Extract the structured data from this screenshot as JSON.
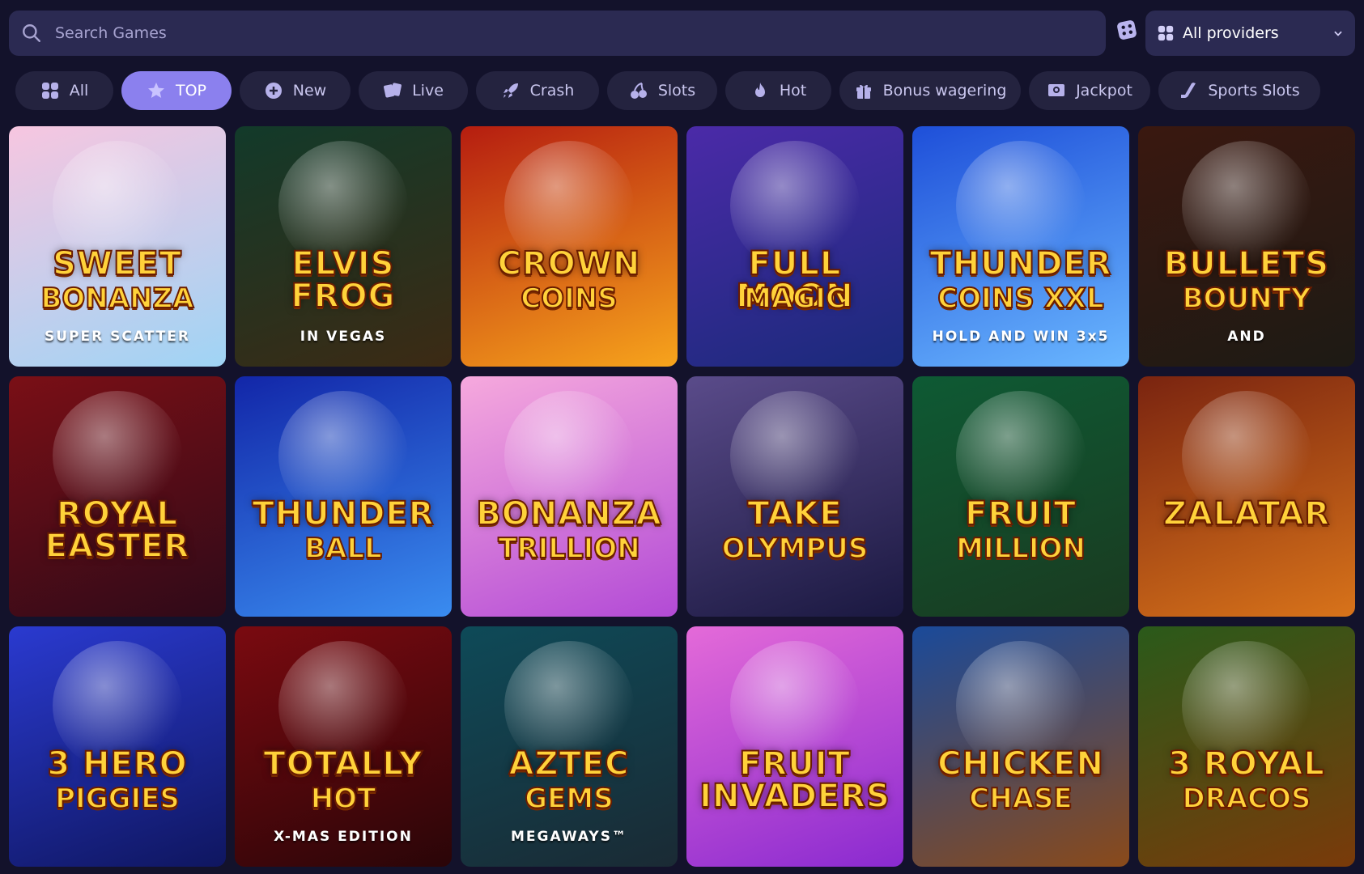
{
  "search": {
    "placeholder": "Search Games"
  },
  "providers": {
    "label": "All providers"
  },
  "tabs": [
    {
      "label": "All",
      "icon": "grid-icon"
    },
    {
      "label": "TOP",
      "icon": "star-icon",
      "active": true
    },
    {
      "label": "New",
      "icon": "plus-circle-icon"
    },
    {
      "label": "Live",
      "icon": "cards-icon"
    },
    {
      "label": "Crash",
      "icon": "rocket-icon"
    },
    {
      "label": "Slots",
      "icon": "cherries-icon"
    },
    {
      "label": "Hot",
      "icon": "flame-icon"
    },
    {
      "label": "Bonus wagering",
      "icon": "gift-icon"
    },
    {
      "label": "Jackpot",
      "icon": "jackpot-icon"
    },
    {
      "label": "Sports Slots",
      "icon": "hockey-icon"
    }
  ],
  "games": [
    {
      "line1": "SWEET",
      "line2": "BONANZA",
      "line3": "SUPER SCATTER",
      "bg": [
        "#f7c6e0",
        "#9fd4f5"
      ]
    },
    {
      "line1": "ELVIS FROG",
      "line2": "",
      "line3": "IN VEGAS",
      "bg": [
        "#123a2a",
        "#3c2a14"
      ]
    },
    {
      "line1": "CROWN",
      "line2": "COINS",
      "line3": "",
      "bg": [
        "#b51d10",
        "#f7a41c"
      ]
    },
    {
      "line1": "FULL MOON",
      "line2": "MAGIC",
      "line3": "",
      "bg": [
        "#4b2aa8",
        "#1a2a7a"
      ]
    },
    {
      "line1": "THUNDER",
      "line2": "COINS XXL",
      "line3": "HOLD AND WIN 3x5",
      "bg": [
        "#1e4fd9",
        "#6ab7ff"
      ]
    },
    {
      "line1": "BULLETS",
      "line2": "BOUNTY",
      "line3": "AND",
      "bg": [
        "#3a1810",
        "#1d1a14"
      ]
    },
    {
      "line1": "ROYAL EASTER",
      "line2": "",
      "line3": "",
      "bg": [
        "#7a0f16",
        "#2f0a18"
      ]
    },
    {
      "line1": "THUNDER",
      "line2": "BALL",
      "line3": "",
      "bg": [
        "#1226a8",
        "#3a8cf0"
      ]
    },
    {
      "line1": "BONANZA",
      "line2": "TRILLION",
      "line3": "",
      "bg": [
        "#f6a9dd",
        "#b24ad6"
      ]
    },
    {
      "line1": "TAKE",
      "line2": "OLYMPUS",
      "line3": "",
      "bg": [
        "#5a4b8a",
        "#1a1840"
      ]
    },
    {
      "line1": "FRUIT",
      "line2": "MILLION",
      "line3": "",
      "bg": [
        "#0e5a34",
        "#1a3a20"
      ]
    },
    {
      "line1": "ZALATAR",
      "line2": "",
      "line3": "",
      "bg": [
        "#7a2410",
        "#d8731a"
      ]
    },
    {
      "line1": "3 HERO",
      "line2": "PIGGIES",
      "line3": "",
      "bg": [
        "#2a3ad0",
        "#0f1660"
      ]
    },
    {
      "line1": "TOTALLY",
      "line2": "HOT",
      "line3": "X-MAS EDITION",
      "bg": [
        "#7a0a10",
        "#2a0508"
      ]
    },
    {
      "line1": "AZTEC",
      "line2": "GEMS",
      "line3": "MEGAWAYS™",
      "bg": [
        "#0e4a58",
        "#1a2a34"
      ]
    },
    {
      "line1": "FRUIT INVADERS",
      "line2": "",
      "line3": "",
      "bg": [
        "#e46ad8",
        "#8a2ad0"
      ]
    },
    {
      "line1": "CHICKEN",
      "line2": "CHASE",
      "line3": "",
      "bg": [
        "#1a4a9a",
        "#8a4a1a"
      ]
    },
    {
      "line1": "3 ROYAL",
      "line2": "DRACOS",
      "line3": "",
      "bg": [
        "#2a5a1a",
        "#7a3a0a"
      ]
    }
  ]
}
